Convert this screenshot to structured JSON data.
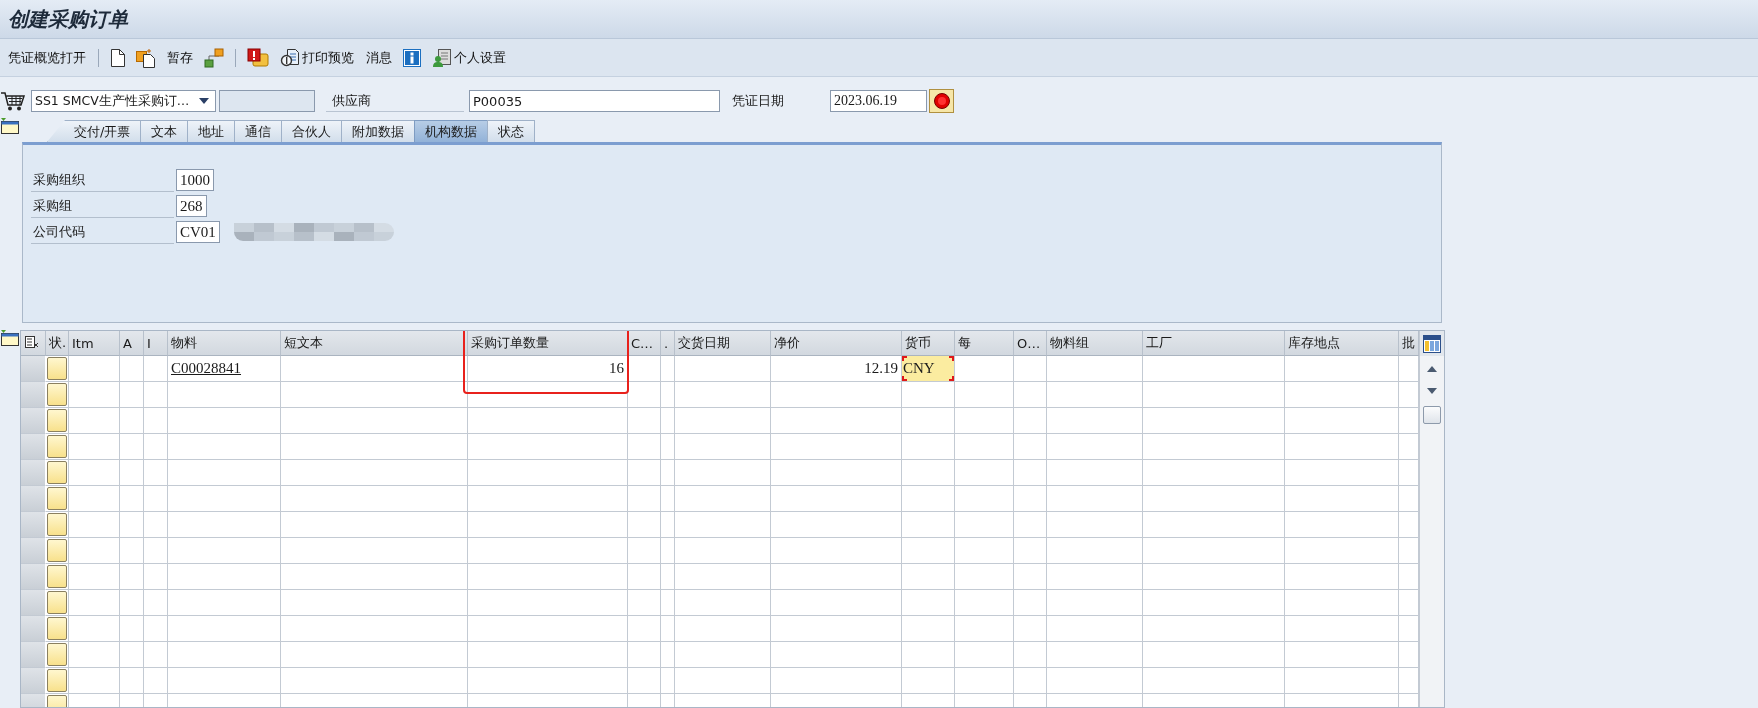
{
  "window": {
    "title": "创建采购订单"
  },
  "toolbar": [
    {
      "kind": "text",
      "label": "凭证概览打开"
    },
    {
      "kind": "separator"
    },
    {
      "kind": "document"
    },
    {
      "kind": "copy"
    },
    {
      "kind": "text",
      "label": "暂存"
    },
    {
      "kind": "hierarchy"
    },
    {
      "kind": "separator"
    },
    {
      "kind": "alert"
    },
    {
      "kind": "preview",
      "label": "打印预览"
    },
    {
      "kind": "text",
      "label": "消息"
    },
    {
      "kind": "info"
    },
    {
      "kind": "settings",
      "label": "个人设置"
    }
  ],
  "header": {
    "order_type": "SS1 SMCV生产性采购订…",
    "vendor_label": "供应商",
    "vendor": "P00035",
    "date_label": "凭证日期",
    "date": "2023.06.19"
  },
  "tabs": [
    {
      "label": "交付/开票",
      "selected": false
    },
    {
      "label": "文本",
      "selected": false
    },
    {
      "label": "地址",
      "selected": false
    },
    {
      "label": "通信",
      "selected": false
    },
    {
      "label": "合伙人",
      "selected": false
    },
    {
      "label": "附加数据",
      "selected": false
    },
    {
      "label": "机构数据",
      "selected": true
    },
    {
      "label": "状态",
      "selected": false
    }
  ],
  "org_data": {
    "fields": [
      {
        "label": "采购组织",
        "value": "1000"
      },
      {
        "label": "采购组",
        "value": "268"
      },
      {
        "label": "公司代码",
        "value": "CV01"
      }
    ],
    "company_name_redacted": true
  },
  "items": {
    "columns": [
      {
        "label": "状.",
        "kind": "status",
        "highlighted": false
      },
      {
        "label": "Itm",
        "kind": "text",
        "highlighted": false
      },
      {
        "label": "A",
        "kind": "text",
        "highlighted": false
      },
      {
        "label": "I",
        "kind": "text",
        "highlighted": false
      },
      {
        "label": "物料",
        "kind": "material",
        "highlighted": false
      },
      {
        "label": "短文本",
        "kind": "text",
        "highlighted": false
      },
      {
        "label": "采购订单数量",
        "kind": "quantity",
        "highlighted": true
      },
      {
        "label": "C…",
        "kind": "text",
        "highlighted": false
      },
      {
        "label": ".",
        "kind": "text",
        "highlighted": false
      },
      {
        "label": "交货日期",
        "kind": "text",
        "highlighted": false
      },
      {
        "label": "净价",
        "kind": "price",
        "highlighted": false
      },
      {
        "label": "货币",
        "kind": "currency",
        "highlighted": false
      },
      {
        "label": "每",
        "kind": "text",
        "highlighted": false
      },
      {
        "label": "O…",
        "kind": "text",
        "highlighted": false
      },
      {
        "label": "物料组",
        "kind": "text",
        "highlighted": false
      },
      {
        "label": "工厂",
        "kind": "text",
        "highlighted": false
      },
      {
        "label": "库存地点",
        "kind": "text",
        "highlighted": false
      },
      {
        "label": "批",
        "kind": "text",
        "highlighted": false
      }
    ],
    "rows": [
      {
        "kind": "item",
        "material": "C00028841",
        "quantity": "16",
        "net_price": "12.19",
        "currency": "CNY",
        "currency_required": true
      },
      {
        "kind": "empty"
      },
      {
        "kind": "empty"
      },
      {
        "kind": "empty"
      },
      {
        "kind": "empty"
      },
      {
        "kind": "empty"
      },
      {
        "kind": "empty"
      },
      {
        "kind": "empty"
      },
      {
        "kind": "empty"
      },
      {
        "kind": "empty"
      },
      {
        "kind": "empty"
      },
      {
        "kind": "empty"
      },
      {
        "kind": "empty"
      },
      {
        "kind": "empty"
      }
    ]
  }
}
